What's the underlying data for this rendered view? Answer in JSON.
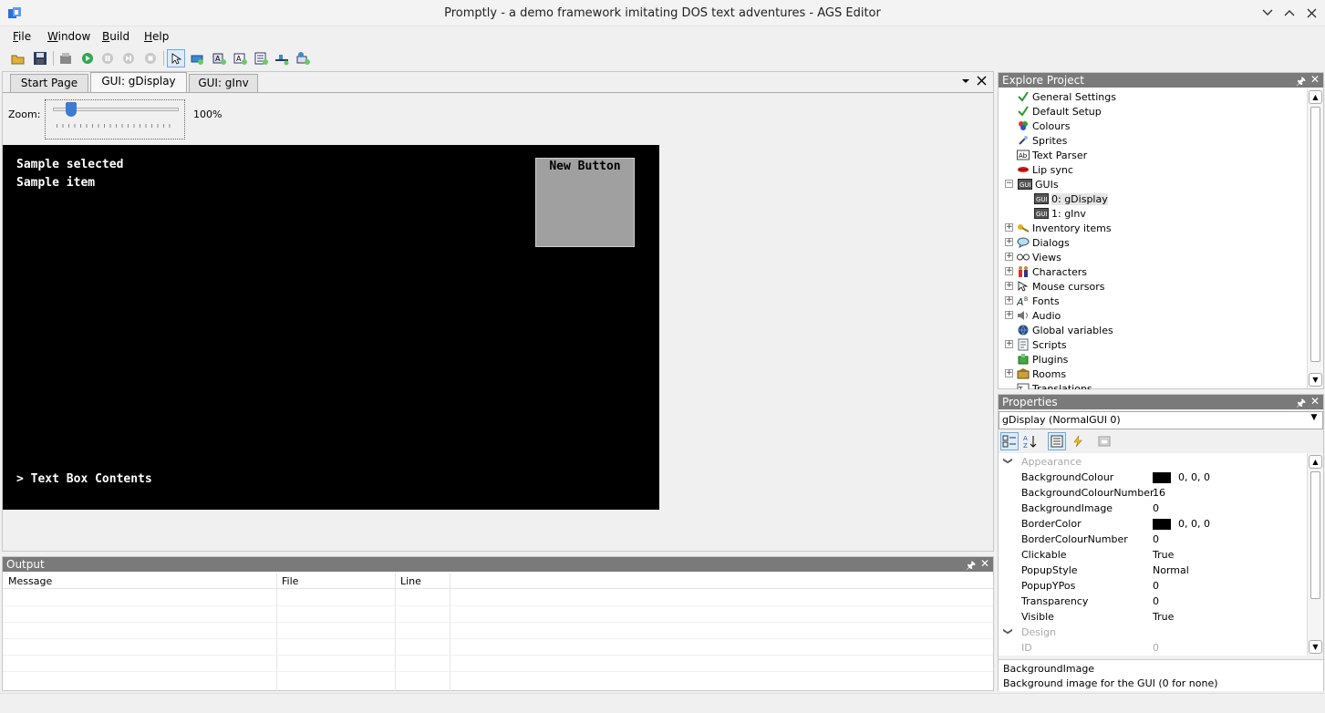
{
  "window": {
    "title": "Promptly - a demo framework imitating DOS text adventures - AGS Editor"
  },
  "menu": [
    {
      "label": "File",
      "key": "F",
      "rest": "ile"
    },
    {
      "label": "Window",
      "key": "W",
      "rest": "indow"
    },
    {
      "label": "Build",
      "key": "B",
      "rest": "uild"
    },
    {
      "label": "Help",
      "key": "H",
      "rest": "elp"
    }
  ],
  "toolbar": {
    "icons": [
      "open-icon",
      "save-icon",
      "build-icon",
      "run-icon",
      "pause-icon",
      "step-icon",
      "stop-icon",
      "select-icon",
      "add-button-icon",
      "add-label-icon",
      "add-textbox-icon",
      "add-listbox-icon",
      "add-slider-icon",
      "add-inventory-icon"
    ]
  },
  "editor": {
    "tabs": [
      "Start Page",
      "GUI: gDisplay",
      "GUI: gInv"
    ],
    "selected_tab": 1,
    "zoom_label": "Zoom:",
    "zoom_value": "100%",
    "zoom_fraction": 0.1,
    "gui": {
      "line1": "Sample selected",
      "line2": "Sample item",
      "button_text": "New Button",
      "textbox": "Text Box Contents"
    }
  },
  "output": {
    "title": "Output",
    "columns": [
      "Message",
      "File",
      "Line"
    ]
  },
  "explore": {
    "title": "Explore Project",
    "items": [
      {
        "label": "General Settings",
        "icon": "check-icon",
        "expandable": false
      },
      {
        "label": "Default Setup",
        "icon": "check-icon",
        "expandable": false
      },
      {
        "label": "Colours",
        "icon": "palette-icon",
        "expandable": false
      },
      {
        "label": "Sprites",
        "icon": "sprite-icon",
        "expandable": false
      },
      {
        "label": "Text Parser",
        "icon": "textparser-icon",
        "expandable": false
      },
      {
        "label": "Lip sync",
        "icon": "lips-icon",
        "expandable": false
      },
      {
        "label": "GUIs",
        "icon": "gui-icon",
        "expandable": true,
        "expanded": true
      },
      {
        "label": "0: gDisplay",
        "icon": "gui-icon",
        "child": true,
        "selected": true
      },
      {
        "label": "1: gInv",
        "icon": "gui-icon",
        "child": true
      },
      {
        "label": "Inventory items",
        "icon": "key-icon",
        "expandable": true
      },
      {
        "label": "Dialogs",
        "icon": "dialog-icon",
        "expandable": true
      },
      {
        "label": "Views",
        "icon": "views-icon",
        "expandable": true
      },
      {
        "label": "Characters",
        "icon": "characters-icon",
        "expandable": true
      },
      {
        "label": "Mouse cursors",
        "icon": "cursor-icon",
        "expandable": true
      },
      {
        "label": "Fonts",
        "icon": "font-icon",
        "expandable": true
      },
      {
        "label": "Audio",
        "icon": "audio-icon",
        "expandable": true
      },
      {
        "label": "Global variables",
        "icon": "globe-icon",
        "expandable": false
      },
      {
        "label": "Scripts",
        "icon": "scripts-icon",
        "expandable": true
      },
      {
        "label": "Plugins",
        "icon": "plugin-icon",
        "expandable": false
      },
      {
        "label": "Rooms",
        "icon": "rooms-icon",
        "expandable": true
      },
      {
        "label": "Translations",
        "icon": "translation-icon",
        "expandable": false
      }
    ]
  },
  "properties": {
    "title": "Properties",
    "object": "gDisplay (NormalGUI 0)",
    "categories": [
      "Appearance",
      "Design"
    ],
    "rows": [
      {
        "name": "BackgroundColour",
        "value": "0, 0, 0",
        "swatch": "#000000"
      },
      {
        "name": "BackgroundColourNumber",
        "value": "16"
      },
      {
        "name": "BackgroundImage",
        "value": "0"
      },
      {
        "name": "BorderColor",
        "value": "0, 0, 0",
        "swatch": "#000000"
      },
      {
        "name": "BorderColourNumber",
        "value": "0"
      },
      {
        "name": "Clickable",
        "value": "True"
      },
      {
        "name": "PopupStyle",
        "value": "Normal"
      },
      {
        "name": "PopupYPos",
        "value": "0"
      },
      {
        "name": "Transparency",
        "value": "0"
      },
      {
        "name": "Visible",
        "value": "True"
      }
    ],
    "design_rows": [
      {
        "name": "ID",
        "value": "0"
      }
    ],
    "desc_title": "BackgroundImage",
    "desc_text": "Background image for the GUI (0 for none)"
  }
}
